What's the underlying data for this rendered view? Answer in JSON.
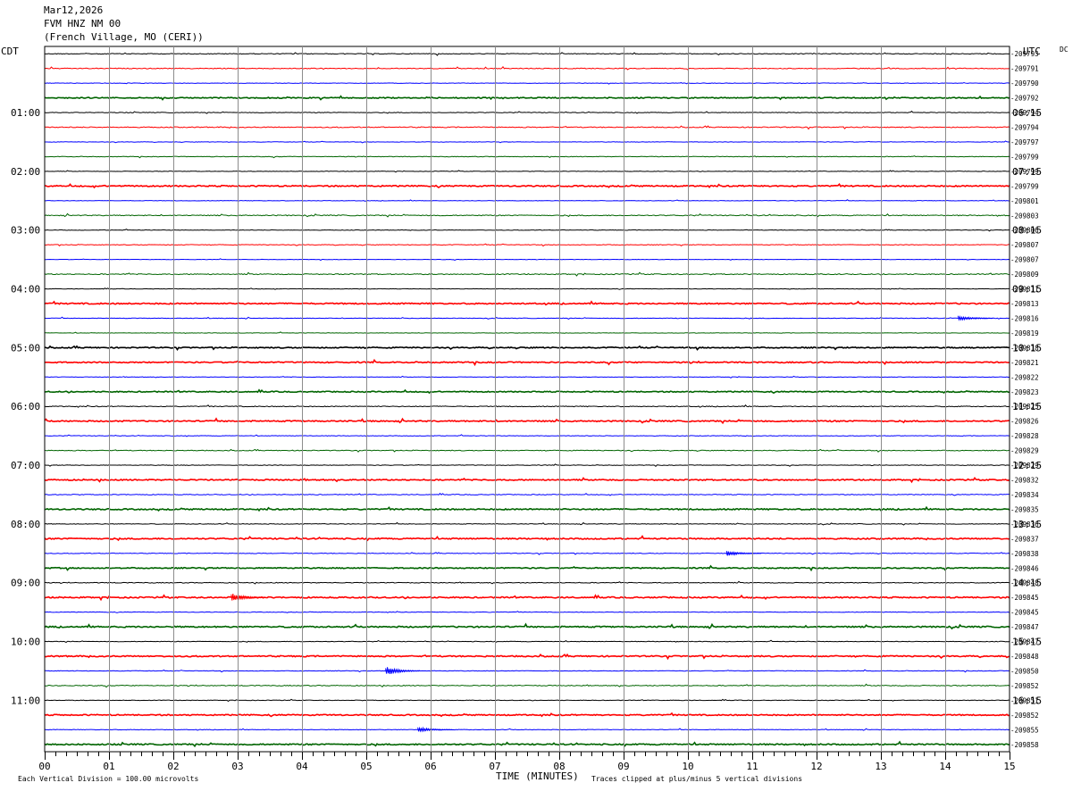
{
  "header": {
    "date": "Mar12,2026",
    "station": "FVM HNZ NM 00",
    "location": "(French Village, MO (CERI))"
  },
  "left_tz": "CDT",
  "right_tz": "UTC",
  "dc_label": "DC",
  "footer": {
    "division_note": "Each Vertical Division =  100.00 microvolts",
    "xlabel": "TIME (MINUTES)",
    "clip_note": "Traces clipped at plus/minus 5 vertical divisions"
  },
  "chart_data": {
    "type": "line",
    "title": "FVM HNZ NM 00",
    "xlabel": "TIME (MINUTES)",
    "ylabel": "",
    "xlim": [
      0,
      15
    ],
    "x_ticks": [
      "00",
      "01",
      "02",
      "03",
      "04",
      "05",
      "06",
      "07",
      "08",
      "09",
      "10",
      "11",
      "12",
      "13",
      "14",
      "15"
    ],
    "grid": true,
    "trace_colors": [
      "#000000",
      "#ff0000",
      "#0000ff",
      "#006400"
    ],
    "left_hour_labels": [
      "01:00",
      "02:00",
      "03:00",
      "04:00",
      "05:00",
      "06:00",
      "07:00",
      "08:00",
      "09:00",
      "10:00",
      "11:00"
    ],
    "right_hour_labels": [
      "06:15",
      "07:15",
      "08:15",
      "09:15",
      "10:15",
      "11:15",
      "12:15",
      "13:15",
      "14:15",
      "15:15",
      "16:15"
    ],
    "dc_offsets": [
      "-209793",
      "-209791",
      "-209790",
      "-209792",
      "-209794",
      "-209794",
      "-209797",
      "-209799",
      "-209799",
      "-209799",
      "-209801",
      "-209803",
      "-209806",
      "-209807",
      "-209807",
      "-209809",
      "-209811",
      "-209813",
      "-209816",
      "-209819",
      "-209818",
      "-209821",
      "-209822",
      "-209823",
      "-209825",
      "-209826",
      "-209828",
      "-209829",
      "-209829",
      "-209832",
      "-209834",
      "-209835",
      "-209836",
      "-209837",
      "-209838",
      "-209846",
      "-209848",
      "-209845",
      "-209845",
      "-209847",
      "-209847",
      "-209848",
      "-209850",
      "-209852",
      "-209851",
      "-209852",
      "-209855",
      "-209858"
    ],
    "noise_level": [
      0.8,
      0.9,
      0.5,
      1.1,
      0.7,
      1.0,
      0.5,
      0.6,
      0.5,
      1.3,
      0.5,
      1.0,
      0.5,
      0.7,
      0.4,
      1.0,
      0.5,
      1.3,
      0.6,
      0.5,
      1.1,
      1.2,
      0.5,
      1.1,
      0.9,
      1.3,
      0.6,
      0.8,
      0.6,
      1.2,
      0.8,
      1.3,
      0.7,
      1.3,
      0.7,
      1.1,
      0.8,
      1.3,
      0.6,
      1.4,
      0.6,
      1.3,
      0.6,
      0.9,
      0.6,
      1.2,
      0.6,
      1.3
    ],
    "events": [
      {
        "trace": 37,
        "minute": 2.9,
        "amplitude": 5
      },
      {
        "trace": 42,
        "minute": 5.3,
        "amplitude": 5
      },
      {
        "trace": 34,
        "minute": 10.6,
        "amplitude": 3
      },
      {
        "trace": 18,
        "minute": 14.2,
        "amplitude": 3
      },
      {
        "trace": 46,
        "minute": 5.8,
        "amplitude": 3
      }
    ]
  }
}
